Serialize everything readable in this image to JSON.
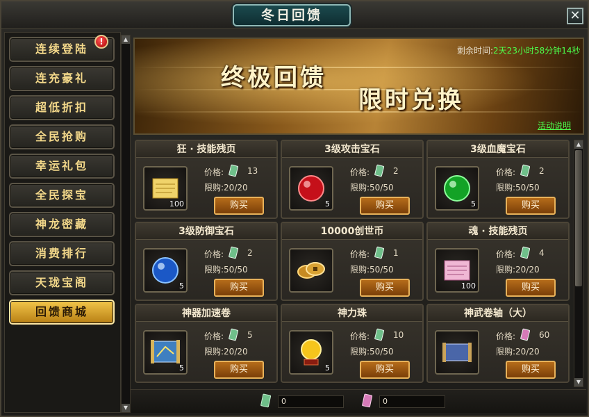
{
  "window": {
    "title": "冬日回馈",
    "close_label": "✕"
  },
  "sidebar": {
    "alert": "!",
    "items": [
      {
        "label": "连续登陆"
      },
      {
        "label": "连充豪礼"
      },
      {
        "label": "超低折扣"
      },
      {
        "label": "全民抢购"
      },
      {
        "label": "幸运礼包"
      },
      {
        "label": "全民探宝"
      },
      {
        "label": "神龙密藏"
      },
      {
        "label": "消费排行"
      },
      {
        "label": "天珑宝阁"
      },
      {
        "label": "回馈商城",
        "active": true
      }
    ]
  },
  "banner": {
    "headline": "终极回馈",
    "subline": "限时兑换",
    "remaining_label": "剩余时间:",
    "remaining_value": "2天23小时58分钟14秒",
    "rules_link": "活动说明"
  },
  "labels": {
    "price": "价格:",
    "limit": "限购:",
    "buy": "购买"
  },
  "items": [
    {
      "name": "狂 · 技能残页",
      "price": "13",
      "limit": "20/20",
      "qty": "100",
      "icon": "scroll-page-icon",
      "coupon": "green"
    },
    {
      "name": "3级攻击宝石",
      "price": "2",
      "limit": "50/50",
      "qty": "5",
      "icon": "red-gem-icon",
      "coupon": "green"
    },
    {
      "name": "3级血魔宝石",
      "price": "2",
      "limit": "50/50",
      "qty": "5",
      "icon": "green-gem-icon",
      "coupon": "green"
    },
    {
      "name": "3级防御宝石",
      "price": "2",
      "limit": "50/50",
      "qty": "5",
      "icon": "blue-gem-icon",
      "coupon": "green"
    },
    {
      "name": "10000创世币",
      "price": "1",
      "limit": "50/50",
      "qty": "",
      "icon": "coin-icon",
      "coupon": "green"
    },
    {
      "name": "魂 · 技能残页",
      "price": "4",
      "limit": "20/20",
      "qty": "100",
      "icon": "pink-scroll-page-icon",
      "coupon": "green"
    },
    {
      "name": "神器加速卷",
      "price": "5",
      "limit": "20/20",
      "qty": "5",
      "icon": "map-scroll-icon",
      "coupon": "green"
    },
    {
      "name": "神力珠",
      "price": "10",
      "limit": "50/50",
      "qty": "5",
      "icon": "golden-orb-icon",
      "coupon": "green"
    },
    {
      "name": "神武卷轴（大）",
      "price": "60",
      "limit": "20/20",
      "qty": "",
      "icon": "scroll-icon",
      "coupon": "pink"
    }
  ],
  "footer": {
    "green_balance": "0",
    "pink_balance": "0"
  },
  "colors": {
    "accent_gold": "#f3d88a",
    "highlight_green": "#4cff4c",
    "buy_orange": "#b56c1a"
  }
}
